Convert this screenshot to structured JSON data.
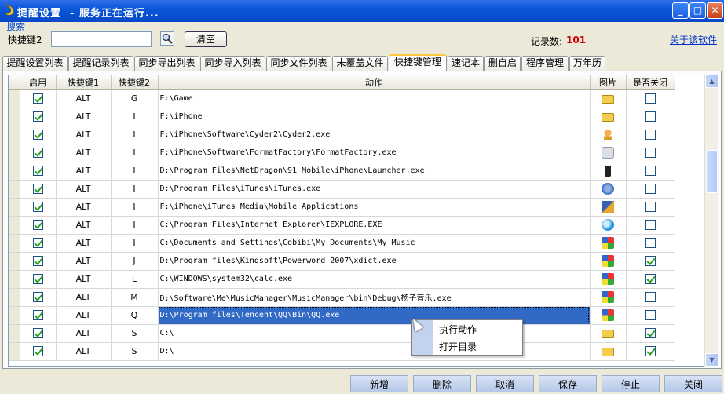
{
  "window": {
    "title": "提醒设置  - 服务正在运行..."
  },
  "search": {
    "group_label": "搜索",
    "field_label": "快捷键2",
    "value": "",
    "clear_label": "清空",
    "count_label": "记录数:",
    "count_value": "101",
    "about_label": "关于该软件"
  },
  "tabs": [
    {
      "label": "提醒设置列表"
    },
    {
      "label": "提醒记录列表"
    },
    {
      "label": "同步导出列表"
    },
    {
      "label": "同步导入列表"
    },
    {
      "label": "同步文件列表"
    },
    {
      "label": "未覆盖文件"
    },
    {
      "label": "快捷键管理",
      "active": true
    },
    {
      "label": "速记本"
    },
    {
      "label": "删自启"
    },
    {
      "label": "程序管理"
    },
    {
      "label": "万年历"
    }
  ],
  "table": {
    "columns": [
      "启用",
      "快捷键1",
      "快捷键2",
      "动作",
      "图片",
      "是否关闭"
    ],
    "rows": [
      {
        "enabled": true,
        "key1": "ALT",
        "key2": "G",
        "action": "E:\\Game",
        "icon": "folder-icon",
        "close": false
      },
      {
        "enabled": true,
        "key1": "ALT",
        "key2": "I",
        "action": "F:\\iPhone",
        "icon": "folder-icon",
        "close": false
      },
      {
        "enabled": true,
        "key1": "ALT",
        "key2": "I",
        "action": "F:\\iPhone\\Software\\Cyder2\\Cyder2.exe",
        "icon": "cyder-app-icon",
        "close": false
      },
      {
        "enabled": true,
        "key1": "ALT",
        "key2": "I",
        "action": "F:\\iPhone\\Software\\FormatFactory\\FormatFactory.exe",
        "icon": "format-factory-icon",
        "close": false
      },
      {
        "enabled": true,
        "key1": "ALT",
        "key2": "I",
        "action": "D:\\Program Files\\NetDragon\\91 Mobile\\iPhone\\Launcher.exe",
        "icon": "phone-icon",
        "close": false
      },
      {
        "enabled": true,
        "key1": "ALT",
        "key2": "I",
        "action": "D:\\Program Files\\iTunes\\iTunes.exe",
        "icon": "itunes-icon",
        "close": false
      },
      {
        "enabled": true,
        "key1": "ALT",
        "key2": "I",
        "action": "F:\\iPhone\\iTunes Media\\Mobile Applications",
        "icon": "mobile-applications-icon",
        "close": false
      },
      {
        "enabled": true,
        "key1": "ALT",
        "key2": "I",
        "action": "C:\\Program Files\\Internet Explorer\\IEXPLORE.EXE",
        "icon": "internet-explorer-icon",
        "close": false
      },
      {
        "enabled": true,
        "key1": "ALT",
        "key2": "I",
        "action": "C:\\Documents and Settings\\Cobibi\\My Documents\\My Music",
        "icon": "windows-file-icon",
        "close": false
      },
      {
        "enabled": true,
        "key1": "ALT",
        "key2": "J",
        "action": "D:\\Program files\\Kingsoft\\Powerword 2007\\xdict.exe",
        "icon": "windows-file-icon",
        "close": true
      },
      {
        "enabled": true,
        "key1": "ALT",
        "key2": "L",
        "action": "C:\\WINDOWS\\system32\\calc.exe",
        "icon": "windows-file-icon",
        "close": true
      },
      {
        "enabled": true,
        "key1": "ALT",
        "key2": "M",
        "action": "D:\\Software\\Me\\MusicManager\\MusicManager\\bin\\Debug\\杨子音乐.exe",
        "icon": "windows-file-icon",
        "close": false
      },
      {
        "enabled": true,
        "key1": "ALT",
        "key2": "Q",
        "action": "D:\\Program files\\Tencent\\QQ\\Bin\\QQ.exe",
        "icon": "windows-file-icon",
        "close": false,
        "selected": true
      },
      {
        "enabled": true,
        "key1": "ALT",
        "key2": "S",
        "action": "C:\\",
        "icon": "folder-icon",
        "close": true
      },
      {
        "enabled": true,
        "key1": "ALT",
        "key2": "S",
        "action": "D:\\",
        "icon": "folder-icon",
        "close": true
      }
    ]
  },
  "context_menu": {
    "items": [
      "执行动作",
      "打开目录"
    ]
  },
  "buttons": {
    "add": "新增",
    "delete": "删除",
    "cancel": "取消",
    "save": "保存",
    "stop": "停止",
    "close": "关闭"
  }
}
